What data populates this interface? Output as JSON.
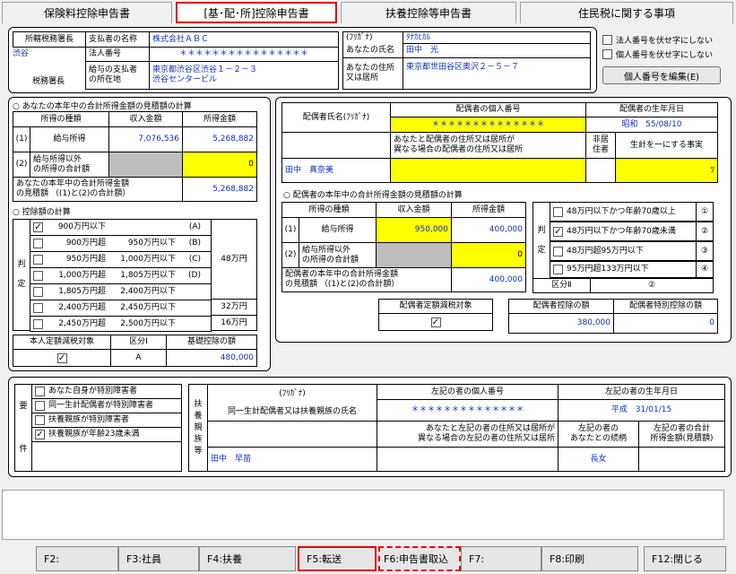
{
  "tabs": [
    "保険料控除申告書",
    "[基･配･所]控除申告書",
    "扶養控除等申告書",
    "住民税に関する事項"
  ],
  "header": {
    "office_label": "所轄税務署長",
    "office_value": "渋谷",
    "office_suffix": "税務署長",
    "payer_name_label": "支払者の名称",
    "payer_name": "株式会社ＡＢＣ",
    "corp_no_label": "法人番号",
    "corp_no": "＊＊＊＊＊＊＊＊＊＊＊＊＊＊＊＊",
    "payer_addr_label_1": "給与の支払者",
    "payer_addr_label_2": "の所在地",
    "payer_addr_1": "東京都渋谷区渋谷１－２－３",
    "payer_addr_2": "渋谷センタービル",
    "furigana_label": "(ﾌﾘｶﾞﾅ)",
    "furigana": "ﾀﾅｶﾋｶﾙ",
    "your_name_label": "あなたの氏名",
    "your_name": "田中　光",
    "your_addr_label_1": "あなたの住所",
    "your_addr_label_2": "又は居所",
    "your_addr": "東京都世田谷区奥沢２－５－７"
  },
  "options": {
    "hide_corp": "法人番号を伏せ字にしない",
    "hide_personal": "個人番号を伏せ字にしない",
    "edit_btn": "個人番号を編集(E)"
  },
  "income": {
    "title": "○  あなたの本年中の合計所得金額の見積額の計算",
    "col_type": "所得の種類",
    "col_revenue": "収入金額",
    "col_income": "所得金額",
    "r1_no": "(1)",
    "r1_label": "給与所得",
    "r1_revenue": "7,076,536",
    "r1_income": "5,268,882",
    "r2_no": "(2)",
    "r2_label_1": "給与所得以外",
    "r2_label_2": "の所得の合計額",
    "r2_income": "0",
    "total_label_1": "あなたの本年中の合計所得金額",
    "total_label_2": "の見積額 （(1)と(2)の合計額）",
    "total": "5,268,882"
  },
  "deduction": {
    "title": "○  控除額の計算",
    "judge": "判",
    "judge2": "定",
    "rows": [
      {
        "a": "900万円以下",
        "b": "",
        "code": "(A)",
        "checked": true
      },
      {
        "a": "900万円超",
        "b": "950万円以下",
        "code": "(B)",
        "checked": false
      },
      {
        "a": "950万円超",
        "b": "1,000万円以下",
        "code": "(C)",
        "checked": false
      },
      {
        "a": "1,000万円超",
        "b": "1,805万円以下",
        "code": "(D)",
        "checked": false
      },
      {
        "a": "1,805万円超",
        "b": "2,400万円以下",
        "code": "",
        "checked": false
      },
      {
        "a": "2,400万円超",
        "b": "2,450万円以下",
        "code": "",
        "checked": false
      },
      {
        "a": "2,450万円超",
        "b": "2,500万円以下",
        "code": "",
        "checked": false
      }
    ],
    "amt_48": "48万円",
    "amt_32": "32万円",
    "amt_16": "16万円",
    "self_limit_label": "本人定額減税対象",
    "kubun1_label": "区分Ⅰ",
    "kubun1": "A",
    "basic_label": "基礎控除の額",
    "basic": "480,000"
  },
  "spouse": {
    "name_label": "配偶者氏名(ﾌﾘｶﾞﾅ)",
    "mynum_label": "配偶者の個人番号",
    "mynum": "＊＊＊＊＊＊＊＊＊＊＊＊＊＊",
    "birth_label": "配偶者の生年月日",
    "birth_era": "昭和",
    "birth": "55/08/10",
    "addr_label_1": "あなたと配偶者の住所又は居所が",
    "addr_label_2": "異なる場合の配偶者の住所又は居所",
    "nonres_1": "非居",
    "nonres_2": "住者",
    "same_label": "生計を一にする事実",
    "name": "田中　真奈美",
    "same_val": "ﾂ",
    "inc_title": "○  配偶者の本年中の合計所得金額の見積額の計算",
    "col_type": "所得の種類",
    "col_revenue": "収入金額",
    "col_income": "所得金額",
    "r1_no": "(1)",
    "r1_label": "給与所得",
    "r1_revenue": "950,000",
    "r1_income": "400,000",
    "r2_no": "(2)",
    "r2_label_1": "給与所得以外",
    "r2_label_2": "の所得の合計額",
    "r2_income": "0",
    "total_label_1": "配偶者の本年中の合計所得金額",
    "total_label_2": "の見積額 （(1)と(2)の合計額）",
    "total": "400,000",
    "judge": "判",
    "judge2": "定",
    "judge_rows": [
      {
        "label": "48万円以下かつ年齢70歳以上",
        "no": "①",
        "checked": false
      },
      {
        "label": "48万円以下かつ年齢70歳未満",
        "no": "②",
        "checked": true
      },
      {
        "label": "48万円超95万円以下",
        "no": "③",
        "checked": false
      },
      {
        "label": "95万円超133万円以下",
        "no": "④",
        "checked": false
      }
    ],
    "kubun2_label": "区分Ⅱ",
    "kubun2": "②",
    "limit_label": "配偶者定額減税対象",
    "sp_ded_label": "配偶者控除の額",
    "sp_ded": "380,000",
    "sp_spec_label": "配偶者特別控除の額",
    "sp_spec": "0"
  },
  "requirements": {
    "yo": "要",
    "ken": "件",
    "items": [
      {
        "label": "あなた自身が特別障害者",
        "checked": false
      },
      {
        "label": "同一生計配偶者が特別障害者",
        "checked": false
      },
      {
        "label": "扶養親族が特別障害者",
        "checked": false
      },
      {
        "label": "扶養親族が年齢23歳未満",
        "checked": true
      }
    ]
  },
  "dependents": {
    "side": [
      "扶",
      "養",
      "親",
      "族",
      "等"
    ],
    "furi_label": "(ﾌﾘｶﾞﾅ)",
    "name_label": "同一生計配偶者又は扶養親族の氏名",
    "mynum_label": "左記の者の個人番号",
    "mynum": "＊＊＊＊＊＊＊＊＊＊＊＊＊＊",
    "birth_label": "左記の者の生年月日",
    "birth": "平成　31/01/15",
    "addr_label_1": "あなたと左記の者の住所又は居所が",
    "addr_label_2": "異なる場合の左記の者の住所又は居所",
    "rel_label_1": "左記の者の",
    "rel_label_2": "あなたとの続柄",
    "inc_label_1": "左記の者の合計",
    "inc_label_2": "所得金額(見積額)",
    "name": "田中　早苗",
    "rel": "長女"
  },
  "fkeys": [
    "F2:",
    "F3:社員",
    "F4:扶養",
    "F5:転送",
    "F6:申告書取込",
    "F7:",
    "F8:印刷",
    "F12:閉じる"
  ]
}
